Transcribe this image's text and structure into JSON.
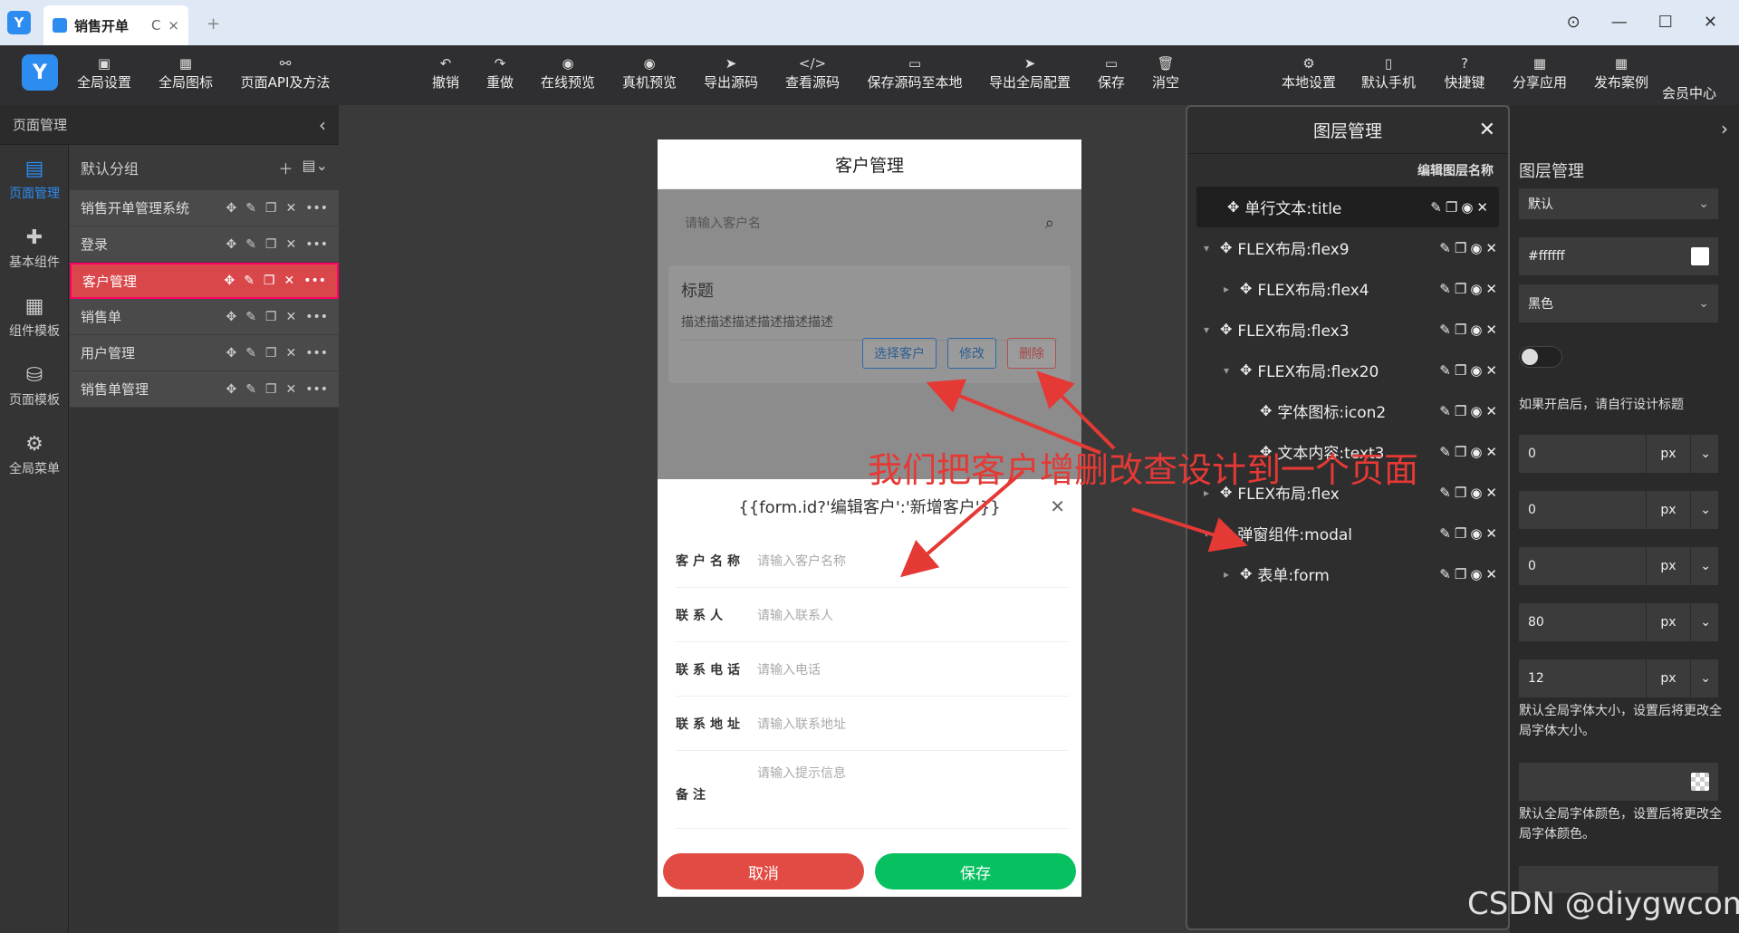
{
  "tab": {
    "title": "销售开单",
    "refresh": "C",
    "close": "×",
    "add": "+"
  },
  "toolbar": [
    {
      "label": "全局设置",
      "icon": "▣"
    },
    {
      "label": "全局图标",
      "icon": "▦"
    },
    {
      "label": "页面API及方法",
      "icon": "⚯"
    },
    {
      "label": "撤销",
      "icon": "↶"
    },
    {
      "label": "重做",
      "icon": "↷"
    },
    {
      "label": "在线预览",
      "icon": "◉"
    },
    {
      "label": "真机预览",
      "icon": "◉"
    },
    {
      "label": "导出源码",
      "icon": "➤"
    },
    {
      "label": "查看源码",
      "icon": "</>"
    },
    {
      "label": "保存源码至本地",
      "icon": "▭"
    },
    {
      "label": "导出全局配置",
      "icon": "➤"
    },
    {
      "label": "保存",
      "icon": "▭"
    },
    {
      "label": "消空",
      "icon": "🗑"
    },
    {
      "label": "本地设置",
      "icon": "⚙"
    },
    {
      "label": "默认手机",
      "icon": "▯"
    },
    {
      "label": "快捷键",
      "icon": "?"
    },
    {
      "label": "分享应用",
      "icon": "▦"
    },
    {
      "label": "发布案例",
      "icon": "▦"
    },
    {
      "label": "会员中心",
      "icon": ""
    }
  ],
  "panel": {
    "title": "页面管理",
    "group": "默认分组"
  },
  "rail": [
    {
      "label": "页面管理",
      "icon": "▤"
    },
    {
      "label": "基本组件",
      "icon": "✚"
    },
    {
      "label": "组件模板",
      "icon": "▦"
    },
    {
      "label": "页面模板",
      "icon": "⛁"
    },
    {
      "label": "全局菜单",
      "icon": "⚙"
    }
  ],
  "pages": [
    "销售开单管理系统",
    "登录",
    "客户管理",
    "销售单",
    "用户管理",
    "销售单管理"
  ],
  "phone": {
    "title": "客户管理",
    "search_placeholder": "请输入客户名",
    "card_title": "标题",
    "card_desc": "描述描述描述描述描述描述",
    "btn_select": "选择客户",
    "btn_edit": "修改",
    "btn_delete": "删除",
    "modal_title": "{{form.id?'编辑客户':'新增客户'}}",
    "fields": [
      {
        "label": "客户名称",
        "placeholder": "请输入客户名称"
      },
      {
        "label": "联系人",
        "placeholder": "请输入联系人"
      },
      {
        "label": "联系电话",
        "placeholder": "请输入电话"
      },
      {
        "label": "联系地址",
        "placeholder": "请输入联系地址"
      },
      {
        "label": "备注",
        "placeholder": "请输入提示信息"
      }
    ],
    "cancel": "取消",
    "save": "保存"
  },
  "layers": {
    "title": "图层管理",
    "sub": "编辑图层名称",
    "items": [
      {
        "label": "单行文本:title",
        "depth": 0,
        "twisty": ""
      },
      {
        "label": "FLEX布局:flex9",
        "depth": 0,
        "twisty": "▾"
      },
      {
        "label": "FLEX布局:flex4",
        "depth": 1,
        "twisty": "▸"
      },
      {
        "label": "FLEX布局:flex3",
        "depth": 0,
        "twisty": "▾"
      },
      {
        "label": "FLEX布局:flex20",
        "depth": 1,
        "twisty": "▾"
      },
      {
        "label": "字体图标:icon2",
        "depth": 2,
        "twisty": ""
      },
      {
        "label": "文本内容:text3",
        "depth": 2,
        "twisty": ""
      },
      {
        "label": "FLEX布局:flex",
        "depth": 0,
        "twisty": "▸"
      },
      {
        "label": "弹窗组件:modal",
        "depth": 0,
        "twisty": "▾"
      },
      {
        "label": "表单:form",
        "depth": 1,
        "twisty": "▸"
      }
    ]
  },
  "props": {
    "title": "图层管理",
    "select1": "默认",
    "bgcolor": "#ffffff",
    "select2": "黑色",
    "hint1": "如果开启后，请自行设计标题",
    "num1": "0",
    "num2": "0",
    "num3": "0",
    "num4": "80",
    "num5": "12",
    "unit": "px",
    "hint2": "默认全局字体大小，设置后将更改全局字体大小。",
    "hint3": "默认全局字体颜色，设置后将更改全局字体颜色。"
  },
  "annotation": "我们把客户增删改查设计到一个页面",
  "watermark": "CSDN @diygwcom",
  "colors": {
    "accent": "#2d8cf0",
    "danger": "#e53935",
    "success": "#07c160",
    "active_page": "#d9474a"
  }
}
